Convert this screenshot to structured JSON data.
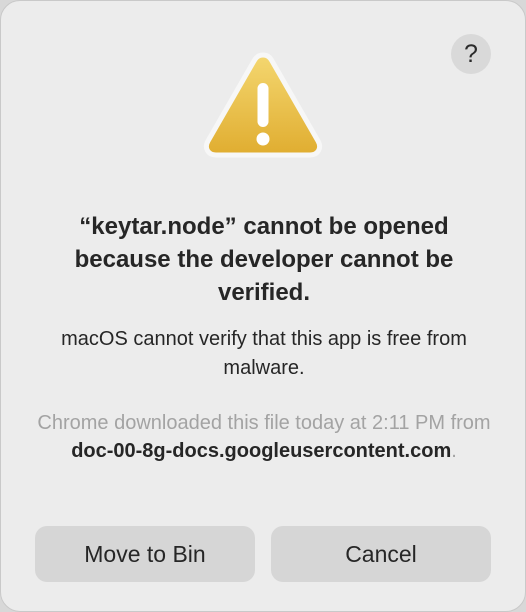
{
  "dialog": {
    "help_label": "?",
    "title": "“keytar.node” cannot be opened because the developer cannot be verified.",
    "message": "macOS cannot verify that this app is free from malware.",
    "source_prefix": "Chrome downloaded this file today at 2:11 PM from ",
    "source_host": "doc-00-8g-docs.googleusercontent.com",
    "source_suffix": ".",
    "buttons": {
      "move_to_bin": "Move to Bin",
      "cancel": "Cancel"
    },
    "icon": "warning-triangle-icon",
    "colors": {
      "warning_yellow": "#e6b73a",
      "background": "#ececec",
      "button": "#d6d6d6"
    }
  }
}
